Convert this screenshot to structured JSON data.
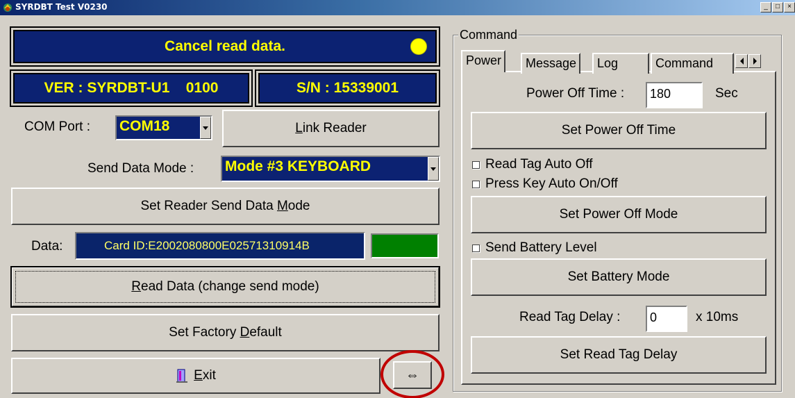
{
  "window": {
    "title": "SYRDBT Test  V0230",
    "minimize": "_",
    "restore": "□",
    "close": "×"
  },
  "status": {
    "message": "Cancel read data.",
    "indicator_color": "#ffff00"
  },
  "version_label": "VER : SYRDBT-U1    0100",
  "serial_label": "S/N : 15339001",
  "com_port": {
    "label": "COM Port :",
    "selected": "COM18"
  },
  "link_reader": {
    "pre": "",
    "accel": "L",
    "post": "ink Reader"
  },
  "send_mode": {
    "label": "Send Data Mode :",
    "selected": "Mode #3 KEYBOARD"
  },
  "set_send_mode": {
    "pre": "Set Reader Send Data ",
    "accel": "M",
    "post": "ode"
  },
  "data": {
    "label": "Data:",
    "value": "Card ID:E2002080800E02571310914B",
    "indicator_color": "#008000"
  },
  "read_data": {
    "pre": "",
    "accel": "R",
    "post": "ead Data (change send mode)"
  },
  "factory_default": {
    "pre": "Set Factory ",
    "accel": "D",
    "post": "efault"
  },
  "exit": {
    "pre": "",
    "accel": "E",
    "post": "xit"
  },
  "toggle_button": "⇔",
  "command_group": {
    "label": "Command",
    "tabs": [
      "Power",
      "Message",
      "Log",
      "Command"
    ],
    "active_tab": "Power"
  },
  "power_tab": {
    "power_off_time_label": "Power Off Time :",
    "power_off_time_value": "180",
    "power_off_time_unit": "Sec",
    "set_power_off_time": "Set Power Off Time",
    "read_tag_auto_off": "Read Tag Auto Off",
    "press_key_auto": "Press Key Auto On/Off",
    "set_power_off_mode": "Set Power Off Mode",
    "send_battery_level": "Send Battery Level",
    "set_battery_mode": "Set Battery Mode",
    "read_tag_delay_label": "Read Tag Delay :",
    "read_tag_delay_value": "0",
    "read_tag_delay_unit": "x 10ms",
    "set_read_tag_delay": "Set Read Tag Delay"
  },
  "annotation_color": "#c00000"
}
